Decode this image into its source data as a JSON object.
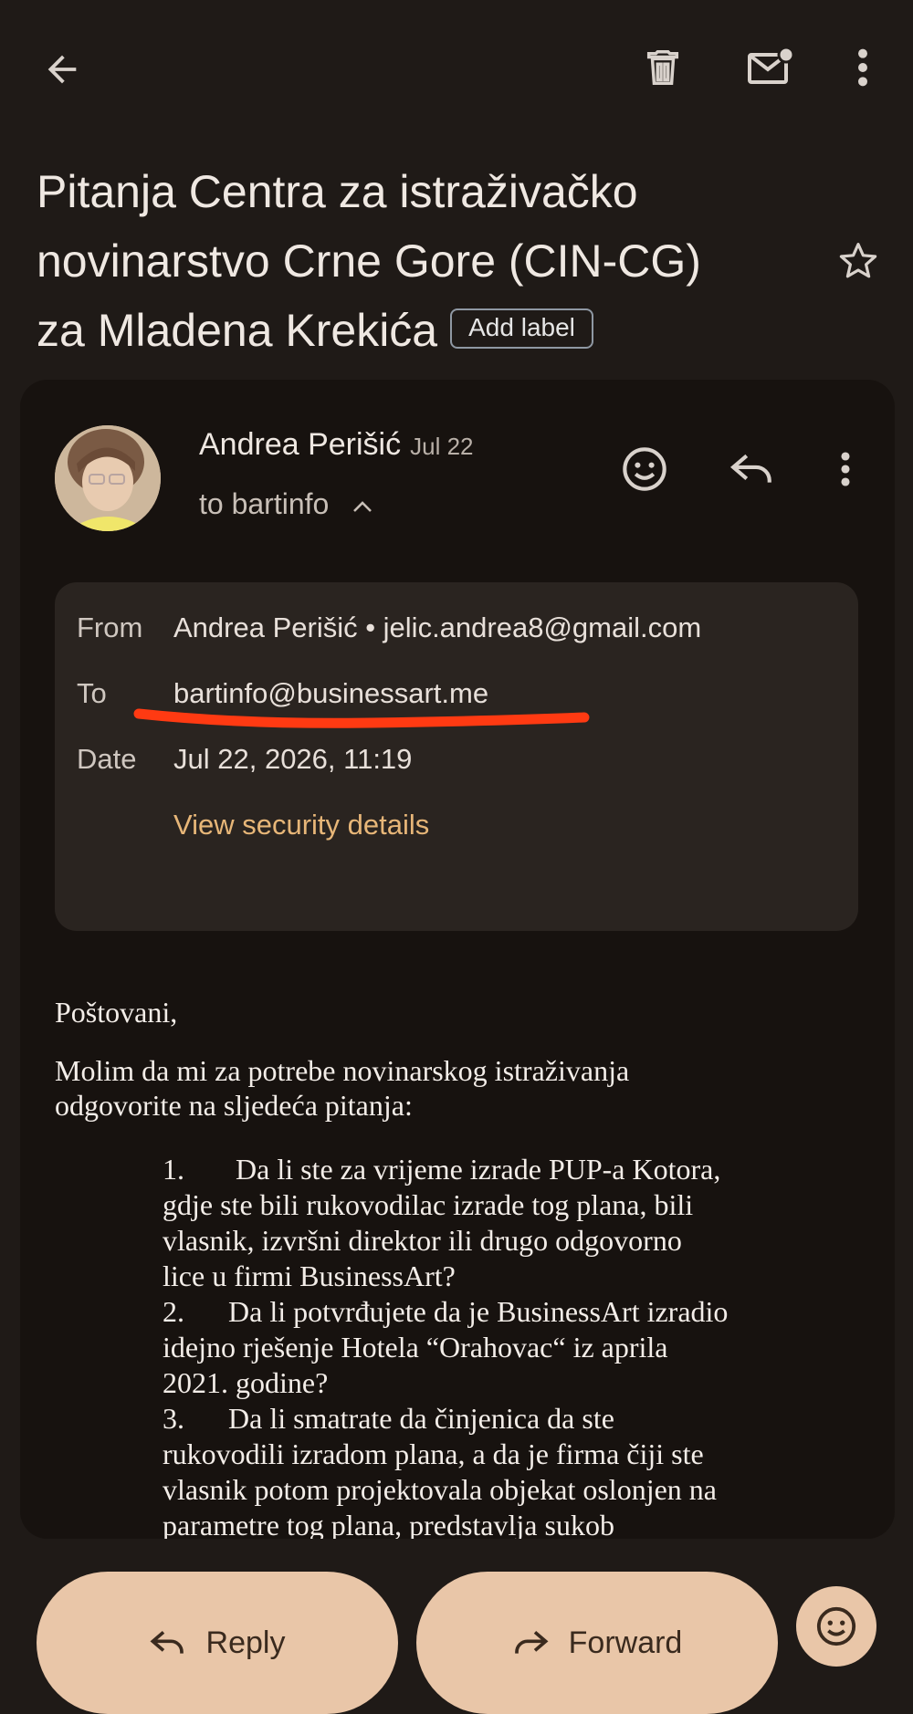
{
  "subject": {
    "line1": "Pitanja Centra za istraživačko",
    "line2": "novinarstvo Crne Gore (CIN-CG)",
    "line3": "za Mladena Krekića",
    "add_label": "Add label"
  },
  "message": {
    "sender_name": "Andrea Perišić",
    "date_short": "Jul 22",
    "to_summary": "to bartinfo",
    "details": {
      "from_label": "From",
      "from_value": "Andrea Perišić • jelic.andrea8@gmail.com",
      "to_label": "To",
      "to_value": "bartinfo@businessart.me",
      "date_label": "Date",
      "date_value": "Jul 22, 2026, 11:19",
      "security_link": "View security details"
    },
    "body": {
      "greeting": "Poštovani,",
      "intro_line1": "Molim da mi za potrebe novinarskog istraživanja",
      "intro_line2": "odgovorite na sljedeća pitanja:",
      "q1_l1": "1.       Da li ste za vrijeme izrade PUP-a Kotora,",
      "q1_l2": "gdje ste bili rukovodilac izrade tog plana, bili",
      "q1_l3": "vlasnik, izvršni direktor ili drugo odgovorno",
      "q1_l4": "lice u firmi BusinessArt?",
      "q2_l1": "2.      Da li potvrđujete da je BusinessArt izradio",
      "q2_l2": "idejno rješenje Hotela “Orahovac“ iz aprila",
      "q2_l3": "2021. godine?",
      "q3_l1": "3.      Da li smatrate da činjenica da ste",
      "q3_l2": "rukovodili izradom plana, a da je firma čiji ste",
      "q3_l3": "vlasnik potom projektovala objekat oslonjen na",
      "q3_l4": "parametre tog plana, predstavlja sukob"
    }
  },
  "actions": {
    "reply_label": "Reply",
    "forward_label": "Forward"
  },
  "colors": {
    "background": "#1f1a17",
    "card": "#17120f",
    "details_bg": "#2a2420",
    "link": "#e7b678",
    "pill": "#e9c6a8",
    "underline_annotation": "#ff3a12"
  },
  "icons": [
    "back-arrow-icon",
    "trash-icon",
    "mark-unread-icon",
    "more-vert-icon",
    "star-icon",
    "emoji-icon",
    "reply-icon",
    "chevron-up-icon",
    "forward-icon"
  ]
}
